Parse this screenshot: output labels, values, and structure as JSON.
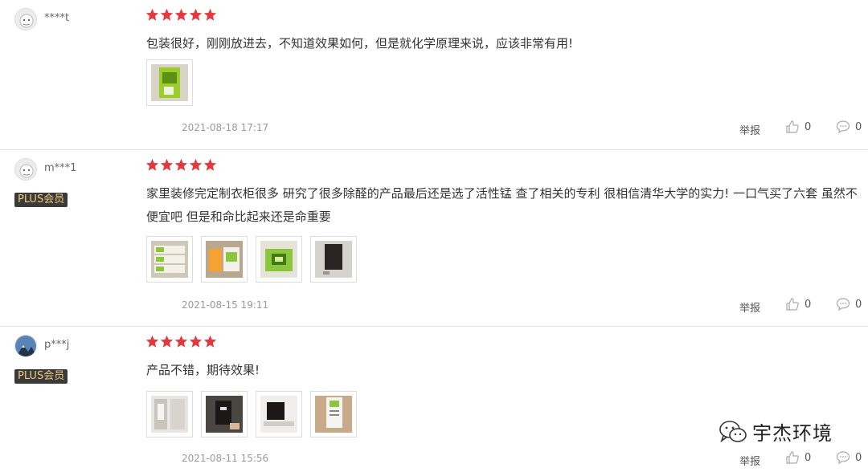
{
  "reviews": [
    {
      "username": "****t",
      "plus_badge": "",
      "rating": 5,
      "content": "包装很好，刚刚放进去，不知道效果如何，但是就化学原理来说，应该非常有用!",
      "images": [
        "product-box-green"
      ],
      "date": "2021-08-18 17:17",
      "report_label": "举报",
      "likes": "0",
      "comments": "0"
    },
    {
      "username": "m***1",
      "plus_badge": "PLUS会员",
      "rating": 5,
      "content": "家里装修完定制衣柜很多 研究了很多除醛的产品最后还是选了活性锰 查了相关的专利 很相信清华大学的实力! 一口气买了六套 虽然不便宜吧 但是和命比起来还是命重要",
      "images": [
        "boxes-stack",
        "boxes-open",
        "product-green-bag",
        "black-pad"
      ],
      "date": "2021-08-15 19:11",
      "report_label": "举报",
      "likes": "0",
      "comments": "0"
    },
    {
      "username": "p***j",
      "plus_badge": "PLUS会员",
      "rating": 5,
      "content": "产品不错，期待效果!",
      "images": [
        "room-closet",
        "black-pad-hand",
        "black-pad-shelf",
        "product-card-hand"
      ],
      "date": "2021-08-11 15:56",
      "report_label": "举报",
      "likes": "0",
      "comments": "0"
    }
  ],
  "watermark": {
    "text": "宇杰环境",
    "icon": "wechat-icon"
  },
  "colors": {
    "star": "#e4393c",
    "plus_bg": "#3a3a3a",
    "plus_text": "#f2c97b",
    "divider": "#e4e4e4"
  }
}
